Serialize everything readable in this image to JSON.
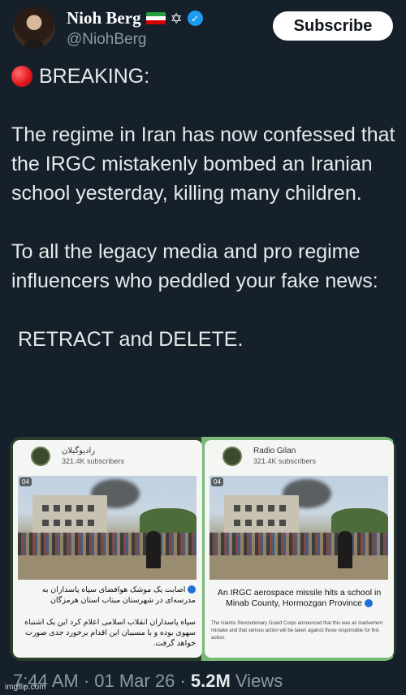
{
  "author": {
    "display_name": "Nioh Berg",
    "handle": "@NiohBerg",
    "flag_icon": "iran-lion-and-sun-flag-icon",
    "star_icon": "star-of-david-icon",
    "verified_icon": "verified-badge-icon",
    "verified_color": "#1d9bf0"
  },
  "subscribe_label": "Subscribe",
  "tweet": {
    "breaking": "BREAKING:",
    "para1": "The regime in Iran has now confessed that the IRGC mistakenly bombed an Iranian school yesterday, killing many children.",
    "para2": "To all the legacy media and pro regime influencers who peddled your fake news:",
    "para3": "RETRACT and DELETE."
  },
  "media": {
    "left": {
      "channel": "رادیوگیلان",
      "subscribers": "321.4K subscribers",
      "badge": "04",
      "caption": "اصابت یک موشک هوافضای سپاه پاسداران به مدرسه‌ای در شهرستان میناب استان هرمزگان",
      "body": "سپاه پاسداران انقلاب اسلامی اعلام کرد این یک اشتباه سهوی بوده و با مسببان این اقدام برخورد جدی صورت خواهد گرفت."
    },
    "right": {
      "channel": "Radio Gilan",
      "subscribers": "321.4K subscribers",
      "badge": "04",
      "caption": "An IRGC aerospace missile hits a school in Minab County, Hormozgan Province",
      "body": "The Islamic Revolutionary Guard Corps announced that this was an inadvertent mistake and that serious action will be taken against those responsible for this action."
    }
  },
  "footer": {
    "time": "7:44 AM · 01 Mar 26 · ",
    "views_count": "5.2M",
    "views_label": " Views"
  },
  "watermark": "imgflip.com",
  "colors": {
    "background": "#15202b",
    "text": "#e7e9ea",
    "muted": "#8b98a5"
  }
}
